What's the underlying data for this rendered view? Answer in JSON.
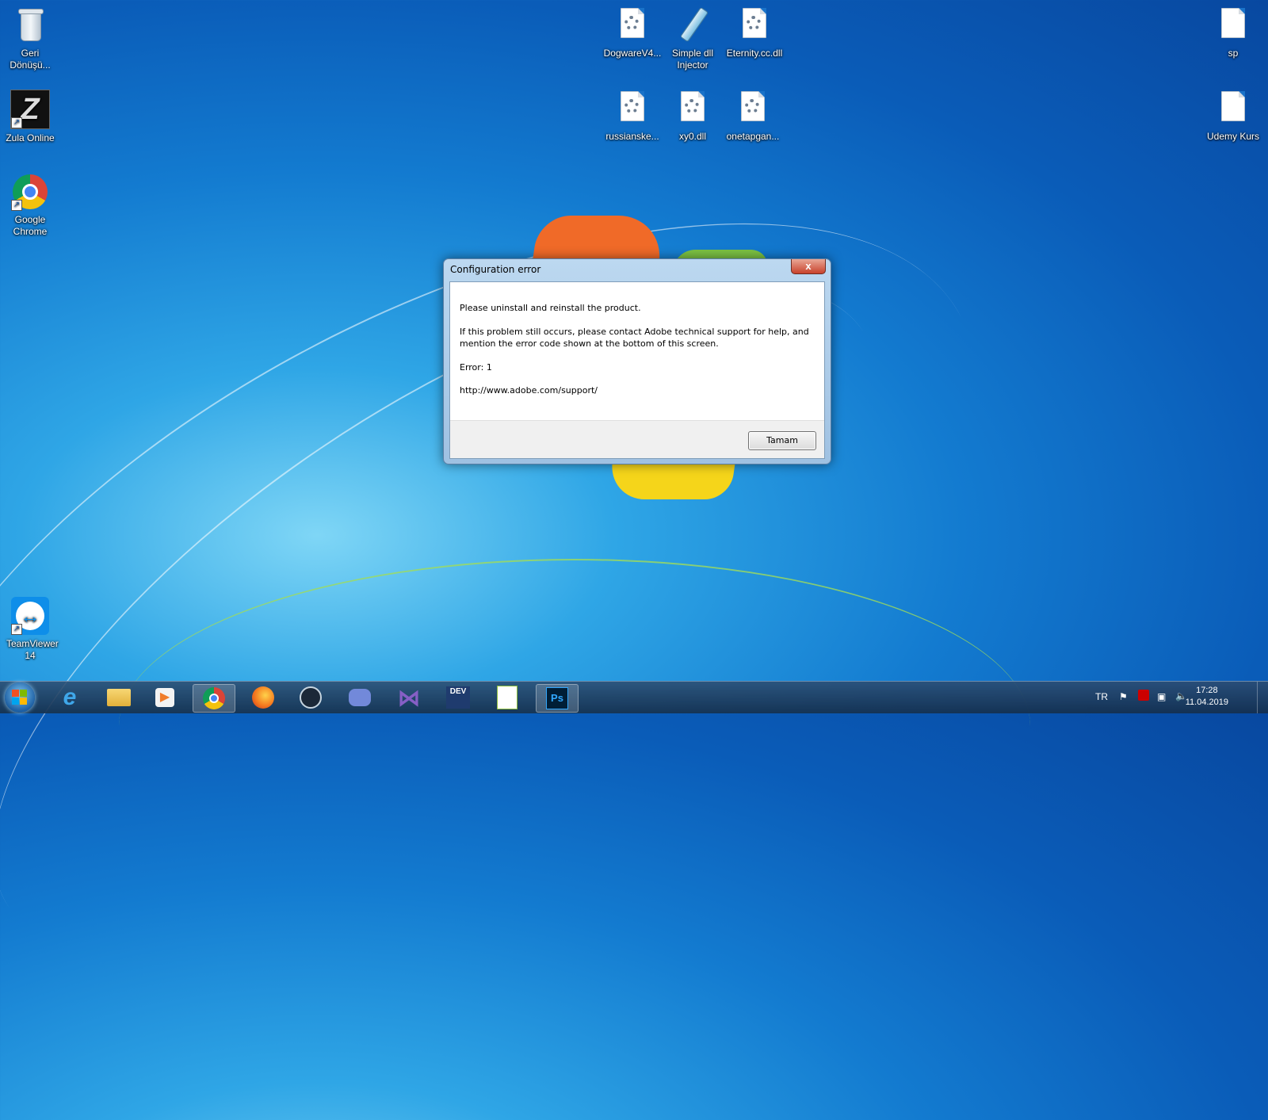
{
  "desktop": {
    "icons_left": [
      {
        "label": "Geri Dönüşü...",
        "icon": "recycle-bin-icon"
      },
      {
        "label": "Zula Online",
        "icon": "zula-icon"
      },
      {
        "label": "Google Chrome",
        "icon": "chrome-icon"
      },
      {
        "label": "TeamViewer 14",
        "icon": "teamviewer-icon"
      }
    ],
    "icons_center_row1": [
      {
        "label": "DogwareV4...",
        "icon": "dll-file-icon"
      },
      {
        "label": "Simple dll Injector",
        "icon": "syringe-icon"
      },
      {
        "label": "Eternity.cc.dll",
        "icon": "dll-file-icon"
      }
    ],
    "icons_center_row2": [
      {
        "label": "russianske...",
        "icon": "dll-file-icon"
      },
      {
        "label": "xy0.dll",
        "icon": "dll-file-icon"
      },
      {
        "label": "onetapgan...",
        "icon": "dll-file-icon"
      }
    ],
    "icons_right": [
      {
        "label": "sp",
        "icon": "text-file-icon"
      },
      {
        "label": "Udemy Kurs",
        "icon": "text-file-icon"
      }
    ]
  },
  "dialog": {
    "title": "Configuration error",
    "close_label": "x",
    "line1": "Please uninstall and reinstall the product.",
    "line2a": "If this problem still occurs, please contact Adobe technical support for help, and",
    "line2b": "mention the error code shown at the bottom of this screen.",
    "error": "Error: 1",
    "url": "http://www.adobe.com/support/",
    "ok_label": "Tamam"
  },
  "taskbar": {
    "apps": [
      "internet-explorer-icon",
      "file-explorer-icon",
      "media-player-icon",
      "chrome-icon",
      "firefox-icon",
      "steam-icon",
      "discord-icon",
      "visual-studio-icon",
      "dev-cpp-icon",
      "notepad-plus-icon",
      "photoshop-icon"
    ],
    "dev_label": "DEV",
    "ps_label": "Ps",
    "language": "TR",
    "time": "17:28",
    "date": "11.04.2019"
  },
  "colors": {
    "dialog_border": "#5b7fa5",
    "close_button": "#c8422b",
    "desktop": "#137bd0"
  }
}
